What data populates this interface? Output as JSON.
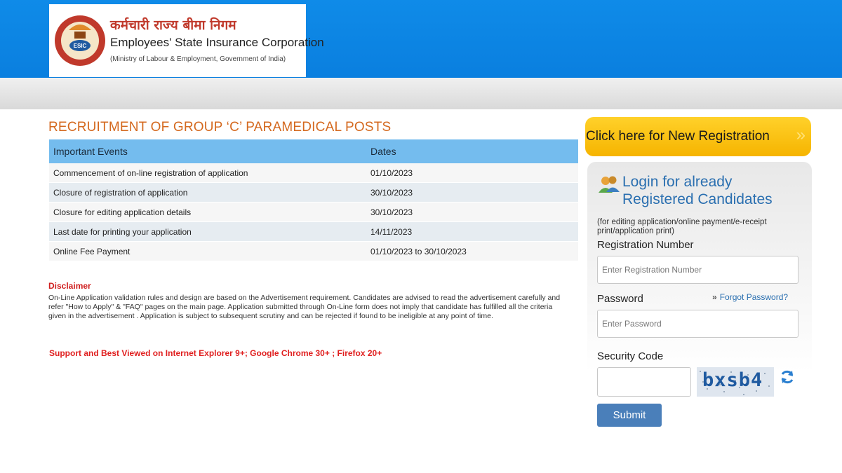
{
  "header": {
    "org_hindi": "कर्मचारी राज्य बीमा निगम",
    "org_english": "Employees' State Insurance Corporation",
    "ministry": "(Ministry of Labour & Employment, Government of India)",
    "logo_text": "ESIC"
  },
  "main": {
    "title": "RECRUITMENT OF GROUP ‘C’ PARAMEDICAL POSTS",
    "table": {
      "headers": [
        "Important Events",
        "Dates"
      ],
      "rows": [
        {
          "event": "Commencement of on-line registration of application",
          "date": "01/10/2023"
        },
        {
          "event": "Closure of registration of application",
          "date": "30/10/2023"
        },
        {
          "event": "Closure for editing application details",
          "date": "30/10/2023"
        },
        {
          "event": "Last date for printing your application",
          "date": "14/11/2023"
        },
        {
          "event": "Online Fee Payment",
          "date": "01/10/2023 to 30/10/2023"
        }
      ]
    },
    "disclaimer_title": "Disclaimer",
    "disclaimer_text": "On-Line Application validation rules and design are based on the Advertisement requirement. Candidates are advised to read the advertisement carefully and refer \"How to Apply\" & \"FAQ\" pages on the main page. Application submitted through On-Line form does not imply that candidate has fulfilled all the criteria given in the advertisement . Application is subject to subsequent scrutiny and can be rejected if found to be ineligible at any point of time.",
    "support_text": "Support and Best Viewed on Internet Explorer 9+; Google Chrome 30+ ; Firefox 20+"
  },
  "sidebar": {
    "new_registration": "Click here for New Registration",
    "login_title_line1": "Login for already",
    "login_title_line2": "Registered Candidates",
    "login_subtitle": "(for editing application/online payment/e-receipt print/application print)",
    "registration_label": "Registration Number",
    "registration_placeholder": "Enter Registration Number",
    "password_label": "Password",
    "forgot_password": "Forgot Password?",
    "password_placeholder": "Enter Password",
    "security_code_label": "Security Code",
    "captcha_text": "bxsb4",
    "submit_label": "Submit"
  },
  "colors": {
    "header_blue": "#0a7fdf",
    "title_orange": "#d4691f",
    "table_header": "#74bcee",
    "disclaimer_red": "#d02020",
    "registration_yellow": "#f6b400",
    "login_blue": "#2a6fb0",
    "submit_blue": "#4a7fba"
  }
}
